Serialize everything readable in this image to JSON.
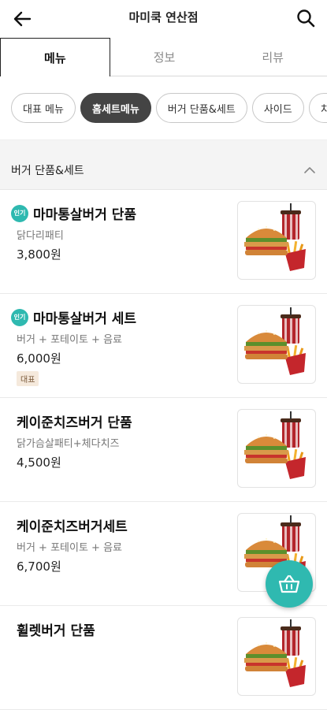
{
  "header": {
    "title": "마미쿡 연산점",
    "back_icon": "arrow-left-icon",
    "search_icon": "search-icon"
  },
  "tabs": [
    {
      "label": "메뉴",
      "active": true
    },
    {
      "label": "정보",
      "active": false
    },
    {
      "label": "리뷰",
      "active": false
    }
  ],
  "chips": [
    {
      "label": "대표 메뉴",
      "selected": false
    },
    {
      "label": "홈세트메뉴",
      "selected": true
    },
    {
      "label": "버거 단품&세트",
      "selected": false
    },
    {
      "label": "사이드",
      "selected": false
    },
    {
      "label": "치킨",
      "selected": false
    }
  ],
  "section": {
    "label": "버거 단품&세트"
  },
  "popular_badge": "인기",
  "items": [
    {
      "name": "마마통살버거 단품",
      "desc": "닭다리패티",
      "price": "3,800원",
      "popular": true,
      "tag": ""
    },
    {
      "name": "마마통살버거 세트",
      "desc": "버거 + 포테이토 + 음료",
      "price": "6,000원",
      "popular": true,
      "tag": "대표"
    },
    {
      "name": "케이준치즈버거 단품",
      "desc": "닭가슴살패티+체다치즈",
      "price": "4,500원",
      "popular": false,
      "tag": ""
    },
    {
      "name": "케이준치즈버거세트",
      "desc": "버거 + 포테이토 + 음료",
      "price": "6,700원",
      "popular": false,
      "tag": ""
    },
    {
      "name": "휠렛버거 단품",
      "desc": "",
      "price": "",
      "popular": false,
      "tag": ""
    }
  ],
  "colors": {
    "accent": "#2fb9b0",
    "chip_selected": "#444444"
  },
  "fab_icon": "basket-icon"
}
